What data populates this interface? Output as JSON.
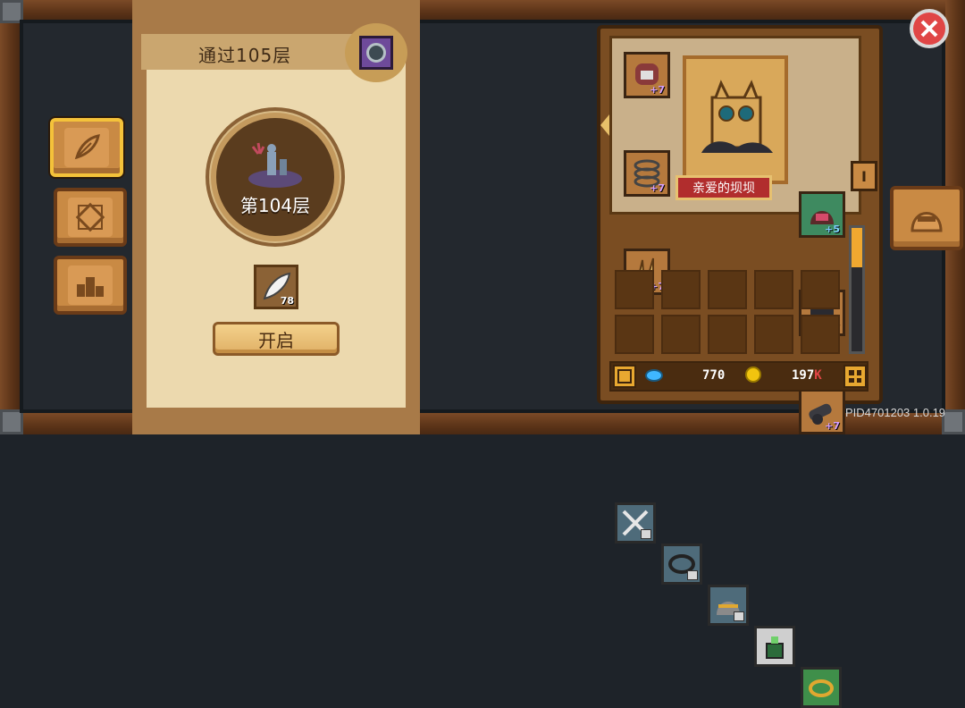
{
  "tower": {
    "next_floor_title": "通过105层",
    "current_floor_label": "第104层",
    "reward_count": "78",
    "open_button_label": "开启"
  },
  "left_tabs": [
    {
      "name": "feather-tab",
      "icon": "feather-icon",
      "active": true
    },
    {
      "name": "diamond-tab",
      "icon": "diamond-icon",
      "active": false
    },
    {
      "name": "podium-tab",
      "icon": "podium-icon",
      "active": false
    }
  ],
  "character": {
    "name": "亲爱的坝坝",
    "equipment_left": [
      {
        "icon": "skull-helmet-icon",
        "level": "+7"
      },
      {
        "icon": "spring-coil-icon",
        "level": "+7"
      },
      {
        "icon": "claw-icon",
        "level": "+7"
      }
    ],
    "equipment_right": [
      {
        "icon": "hood-icon",
        "level": "+5"
      },
      {
        "icon": "dark-armor-icon",
        "level": "+7"
      },
      {
        "icon": "cannon-icon",
        "level": "+7"
      }
    ],
    "rank_badge": "I"
  },
  "inventory": {
    "items": [
      {
        "icon": "crossed-swords-icon",
        "locked": true,
        "color": "#4e6b7a"
      },
      {
        "icon": "bracelet-icon",
        "locked": true,
        "color": "#4e6b7a"
      },
      {
        "icon": "helmet-icon",
        "locked": true,
        "color": "#4e6b7a"
      },
      {
        "icon": "potion-icon",
        "locked": false,
        "color": "#cfcfcf"
      },
      {
        "icon": "ring-icon",
        "locked": false,
        "color": "#3f8f4a"
      }
    ],
    "empty_slots": 10
  },
  "currency": {
    "gems": "770",
    "coins": "197",
    "coins_suffix": "K"
  },
  "build_info": "PID4701203 1.0.19",
  "colors": {
    "accent_gold": "#f4c23a",
    "close_red": "#e04646",
    "gem_blue": "#3fb7ff",
    "coin_gold": "#f1c40f",
    "plus_purple": "#d6a0ff"
  }
}
